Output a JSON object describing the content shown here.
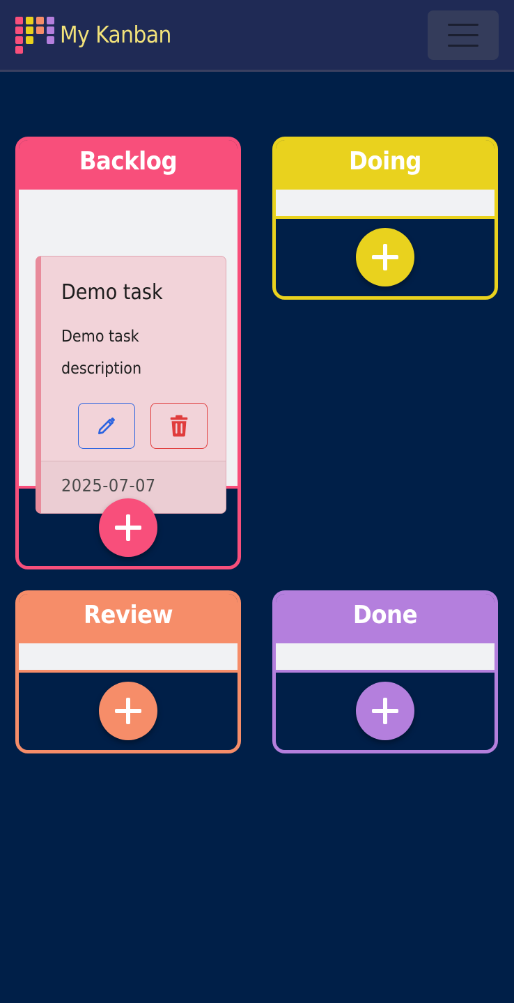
{
  "app": {
    "title": "My Kanban"
  },
  "colors": {
    "background": "#001f48",
    "navbar": "#1f2a55",
    "brand_text": "#f2e27a",
    "backlog": "#f84f7b",
    "doing": "#e9d21e",
    "review": "#f68d69",
    "done": "#b47fdd",
    "edit_blue": "#2c64e0",
    "delete_red": "#e03c3c"
  },
  "navbar": {
    "menu_icon": "hamburger-icon"
  },
  "columns": [
    {
      "title": "Backlog",
      "add_icon": "plus-icon",
      "tasks": [
        {
          "title": "Demo task",
          "description": "Demo task description",
          "date": "2025-07-07",
          "edit_icon": "pencil-icon",
          "delete_icon": "trash-icon"
        }
      ]
    },
    {
      "title": "Doing",
      "add_icon": "plus-icon",
      "tasks": []
    },
    {
      "title": "Review",
      "add_icon": "plus-icon",
      "tasks": []
    },
    {
      "title": "Done",
      "add_icon": "plus-icon",
      "tasks": []
    }
  ]
}
